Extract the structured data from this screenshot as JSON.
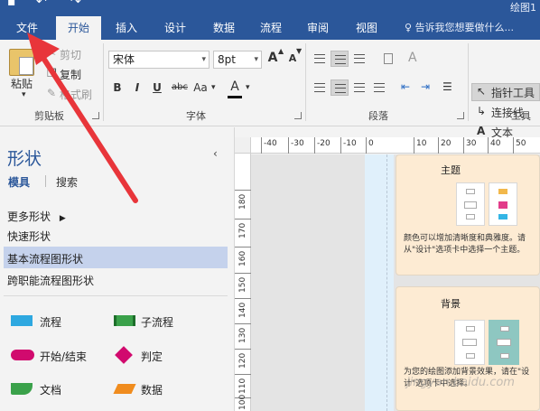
{
  "window": {
    "document_title": "绘图1"
  },
  "tabs": [
    {
      "label": "文件",
      "active": false
    },
    {
      "label": "开始",
      "active": true
    },
    {
      "label": "插入",
      "active": false
    },
    {
      "label": "设计",
      "active": false
    },
    {
      "label": "数据",
      "active": false
    },
    {
      "label": "流程",
      "active": false
    },
    {
      "label": "审阅",
      "active": false
    },
    {
      "label": "视图",
      "active": false
    }
  ],
  "tell_me": "告诉我您想要做什么...",
  "ribbon": {
    "clipboard": {
      "paste": "粘贴",
      "cut": "剪切",
      "copy": "复制",
      "format_painter": "格式刷",
      "label": "剪贴板"
    },
    "font": {
      "name": "宋体",
      "size": "8pt",
      "bold": "B",
      "italic": "I",
      "underline": "U",
      "strike": "abc",
      "case": "Aa",
      "color": "A",
      "grow": "A",
      "shrink": "A",
      "label": "字体"
    },
    "paragraph": {
      "label": "段落"
    },
    "tools": {
      "pointer": "指针工具",
      "connector": "连接线",
      "text": "文本",
      "label": "工具"
    }
  },
  "panel": {
    "title": "形状",
    "collapse": "‹",
    "tabs": [
      "模具",
      "搜索"
    ],
    "links": [
      {
        "label": "更多形状",
        "has_arrow": true
      },
      {
        "label": "快速形状"
      },
      {
        "label": "基本流程图形状",
        "selected": true
      },
      {
        "label": "跨职能流程图形状"
      }
    ],
    "shapes": [
      {
        "label": "流程",
        "color": "#2ea8e0"
      },
      {
        "label": "子流程",
        "color": "#3aa14a"
      },
      {
        "label": "开始/结束",
        "color": "#d10a6e"
      },
      {
        "label": "判定",
        "color": "#d10a6e"
      },
      {
        "label": "文档",
        "color": "#3aa14a"
      },
      {
        "label": "数据",
        "color": "#f08c1e"
      }
    ]
  },
  "ruler": {
    "h_labels": [
      "-40",
      "-30",
      "-20",
      "-10",
      "0",
      "10",
      "20",
      "30",
      "40",
      "50"
    ],
    "v_labels": [
      "180",
      "170",
      "160",
      "150",
      "140",
      "130",
      "120",
      "110",
      "100"
    ]
  },
  "cards": [
    {
      "title": "主题",
      "desc": "颜色可以增加清晰度和典雅度。请从\"设计\"选项卡中选择一个主题。"
    },
    {
      "title": "背景",
      "desc": "为您的绘图添加背景效果，请在\"设计\"选项卡中选择。"
    }
  ],
  "watermark": "jingyan.baidu.com",
  "colors": {
    "accent": "#2b579a",
    "annotation_arrow": "#e8353a"
  }
}
